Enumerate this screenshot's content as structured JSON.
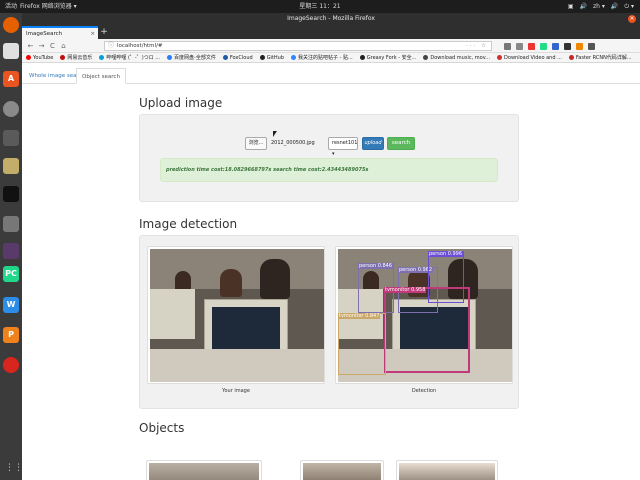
{
  "top_bar": {
    "activities": "活动",
    "app": "Firefox 网络浏览器 ▾",
    "clock": "星期三 11：21",
    "tray": [
      "▣",
      "🔊",
      "zh ▾",
      "🔊",
      "⏻ ▾"
    ]
  },
  "window": {
    "title": "ImageSearch - Mozilla Firefox",
    "close": "×"
  },
  "browser": {
    "tab_title": "ImageSearch",
    "tab_close": "×",
    "new_tab": "+",
    "back": "←",
    "forward": "→",
    "reload": "C",
    "home": "⌂",
    "url": "localhost/html/#",
    "url_actions": "··· ☆",
    "bookmarks": [
      {
        "label": "YouTube",
        "color": "#ff0000"
      },
      {
        "label": "网易云音乐",
        "color": "#c20c0c"
      },
      {
        "label": "哔哩哔哩 (゜-゜)つロ ...",
        "color": "#00a1d6"
      },
      {
        "label": "百度网盘-全部文件",
        "color": "#2b7cff"
      },
      {
        "label": "FoxCloud",
        "color": "#1e5aa8"
      },
      {
        "label": "GitHub",
        "color": "#222222"
      },
      {
        "label": "我关注的贴吧帖子 - 贴...",
        "color": "#3385ff"
      },
      {
        "label": "Greasy Fork - 安全...",
        "color": "#222222"
      },
      {
        "label": "Download music, mov...",
        "color": "#444444"
      },
      {
        "label": "Download Video and ...",
        "color": "#d32f2f"
      },
      {
        "label": "Faster RCNN代码详解...",
        "color": "#c62828"
      }
    ]
  },
  "page": {
    "tabs": [
      "Whole image search",
      "Object search"
    ],
    "upload_heading": "Upload image",
    "file_button": "浏览...",
    "file_name": "2012_000500.jpg",
    "model_select": "resnet101 ▾",
    "upload_button": "upload",
    "search_button": "search",
    "result_text": "prediction time cost:18.0829668797s search time cost:2.43443489075s",
    "detection_heading": "Image detection",
    "caption_left": "Your image",
    "caption_right": "Detection",
    "objects_heading": "Objects",
    "detections": [
      {
        "label": "person 0.846",
        "color": "#7d6fb0"
      },
      {
        "label": "person 0.962",
        "color": "#7d6fb0"
      },
      {
        "label": "person 0.996",
        "color": "#6a4fd6"
      },
      {
        "label": "tvmonitor 0.958",
        "color": "#c0397a"
      },
      {
        "label": "tvmonitor 0.847",
        "color": "#c9a86a"
      }
    ]
  },
  "colors": {
    "accent": "#337ab7",
    "success": "#5cb85c",
    "alert_bg": "#dff0d8"
  }
}
